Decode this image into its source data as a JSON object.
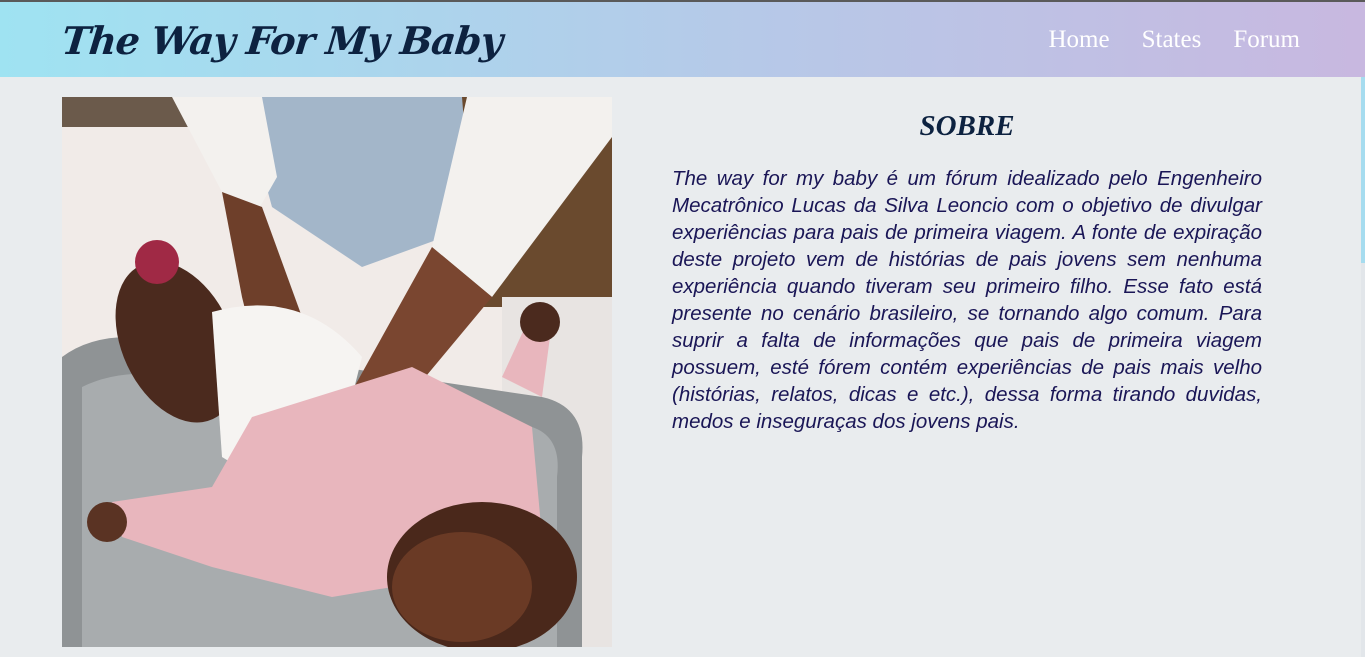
{
  "header": {
    "brand": "The Way For My Baby",
    "nav": [
      "Home",
      "States",
      "Forum"
    ]
  },
  "image": {
    "alt": "Parent changing a baby's diaper; baby in pink outfit lying on changing pad"
  },
  "about": {
    "title": "SOBRE",
    "text": "The way for my baby é um fórum idealizado pelo Engenheiro Mecatrônico Lucas da Silva Leoncio com o objetivo de divulgar experiências para pais de primeira viagem. A fonte de expiração deste projeto vem de histórias de pais jovens sem nenhuma experiência quando tiveram seu primeiro filho. Esse fato está presente no cenário brasileiro, se tornando algo comum. Para suprir a falta de informações que pais de primeira viagem possuem, esté fórem contém experiências de pais mais velho (histórias, relatos, dicas e etc.), dessa forma tirando duvidas, medos e inseguraças dos jovens pais."
  },
  "colors": {
    "header_gradient_start": "#9fe3f2",
    "header_gradient_end": "#c8b8e0",
    "brand": "#0d2240",
    "body_text": "#1a1656",
    "background": "#e9ecee"
  }
}
